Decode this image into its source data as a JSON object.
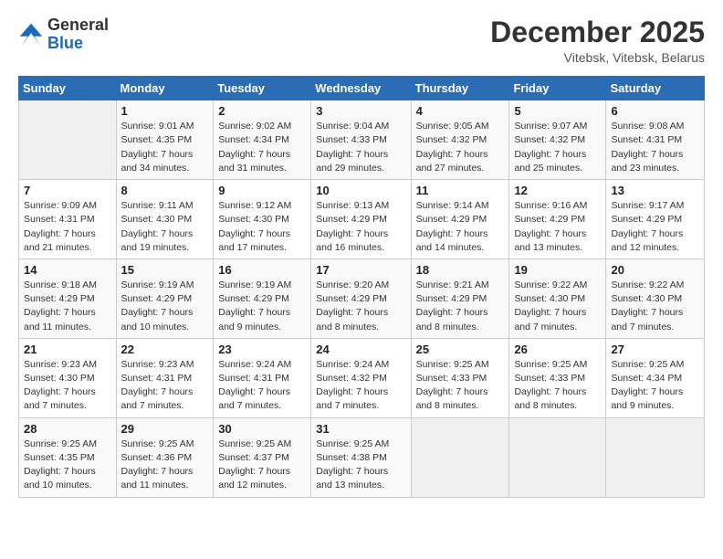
{
  "header": {
    "logo_general": "General",
    "logo_blue": "Blue",
    "month": "December 2025",
    "location": "Vitebsk, Vitebsk, Belarus"
  },
  "weekdays": [
    "Sunday",
    "Monday",
    "Tuesday",
    "Wednesday",
    "Thursday",
    "Friday",
    "Saturday"
  ],
  "weeks": [
    [
      {
        "day": "",
        "sunrise": "",
        "sunset": "",
        "daylight": ""
      },
      {
        "day": "1",
        "sunrise": "Sunrise: 9:01 AM",
        "sunset": "Sunset: 4:35 PM",
        "daylight": "Daylight: 7 hours and 34 minutes."
      },
      {
        "day": "2",
        "sunrise": "Sunrise: 9:02 AM",
        "sunset": "Sunset: 4:34 PM",
        "daylight": "Daylight: 7 hours and 31 minutes."
      },
      {
        "day": "3",
        "sunrise": "Sunrise: 9:04 AM",
        "sunset": "Sunset: 4:33 PM",
        "daylight": "Daylight: 7 hours and 29 minutes."
      },
      {
        "day": "4",
        "sunrise": "Sunrise: 9:05 AM",
        "sunset": "Sunset: 4:32 PM",
        "daylight": "Daylight: 7 hours and 27 minutes."
      },
      {
        "day": "5",
        "sunrise": "Sunrise: 9:07 AM",
        "sunset": "Sunset: 4:32 PM",
        "daylight": "Daylight: 7 hours and 25 minutes."
      },
      {
        "day": "6",
        "sunrise": "Sunrise: 9:08 AM",
        "sunset": "Sunset: 4:31 PM",
        "daylight": "Daylight: 7 hours and 23 minutes."
      }
    ],
    [
      {
        "day": "7",
        "sunrise": "Sunrise: 9:09 AM",
        "sunset": "Sunset: 4:31 PM",
        "daylight": "Daylight: 7 hours and 21 minutes."
      },
      {
        "day": "8",
        "sunrise": "Sunrise: 9:11 AM",
        "sunset": "Sunset: 4:30 PM",
        "daylight": "Daylight: 7 hours and 19 minutes."
      },
      {
        "day": "9",
        "sunrise": "Sunrise: 9:12 AM",
        "sunset": "Sunset: 4:30 PM",
        "daylight": "Daylight: 7 hours and 17 minutes."
      },
      {
        "day": "10",
        "sunrise": "Sunrise: 9:13 AM",
        "sunset": "Sunset: 4:29 PM",
        "daylight": "Daylight: 7 hours and 16 minutes."
      },
      {
        "day": "11",
        "sunrise": "Sunrise: 9:14 AM",
        "sunset": "Sunset: 4:29 PM",
        "daylight": "Daylight: 7 hours and 14 minutes."
      },
      {
        "day": "12",
        "sunrise": "Sunrise: 9:16 AM",
        "sunset": "Sunset: 4:29 PM",
        "daylight": "Daylight: 7 hours and 13 minutes."
      },
      {
        "day": "13",
        "sunrise": "Sunrise: 9:17 AM",
        "sunset": "Sunset: 4:29 PM",
        "daylight": "Daylight: 7 hours and 12 minutes."
      }
    ],
    [
      {
        "day": "14",
        "sunrise": "Sunrise: 9:18 AM",
        "sunset": "Sunset: 4:29 PM",
        "daylight": "Daylight: 7 hours and 11 minutes."
      },
      {
        "day": "15",
        "sunrise": "Sunrise: 9:19 AM",
        "sunset": "Sunset: 4:29 PM",
        "daylight": "Daylight: 7 hours and 10 minutes."
      },
      {
        "day": "16",
        "sunrise": "Sunrise: 9:19 AM",
        "sunset": "Sunset: 4:29 PM",
        "daylight": "Daylight: 7 hours and 9 minutes."
      },
      {
        "day": "17",
        "sunrise": "Sunrise: 9:20 AM",
        "sunset": "Sunset: 4:29 PM",
        "daylight": "Daylight: 7 hours and 8 minutes."
      },
      {
        "day": "18",
        "sunrise": "Sunrise: 9:21 AM",
        "sunset": "Sunset: 4:29 PM",
        "daylight": "Daylight: 7 hours and 8 minutes."
      },
      {
        "day": "19",
        "sunrise": "Sunrise: 9:22 AM",
        "sunset": "Sunset: 4:30 PM",
        "daylight": "Daylight: 7 hours and 7 minutes."
      },
      {
        "day": "20",
        "sunrise": "Sunrise: 9:22 AM",
        "sunset": "Sunset: 4:30 PM",
        "daylight": "Daylight: 7 hours and 7 minutes."
      }
    ],
    [
      {
        "day": "21",
        "sunrise": "Sunrise: 9:23 AM",
        "sunset": "Sunset: 4:30 PM",
        "daylight": "Daylight: 7 hours and 7 minutes."
      },
      {
        "day": "22",
        "sunrise": "Sunrise: 9:23 AM",
        "sunset": "Sunset: 4:31 PM",
        "daylight": "Daylight: 7 hours and 7 minutes."
      },
      {
        "day": "23",
        "sunrise": "Sunrise: 9:24 AM",
        "sunset": "Sunset: 4:31 PM",
        "daylight": "Daylight: 7 hours and 7 minutes."
      },
      {
        "day": "24",
        "sunrise": "Sunrise: 9:24 AM",
        "sunset": "Sunset: 4:32 PM",
        "daylight": "Daylight: 7 hours and 7 minutes."
      },
      {
        "day": "25",
        "sunrise": "Sunrise: 9:25 AM",
        "sunset": "Sunset: 4:33 PM",
        "daylight": "Daylight: 7 hours and 8 minutes."
      },
      {
        "day": "26",
        "sunrise": "Sunrise: 9:25 AM",
        "sunset": "Sunset: 4:33 PM",
        "daylight": "Daylight: 7 hours and 8 minutes."
      },
      {
        "day": "27",
        "sunrise": "Sunrise: 9:25 AM",
        "sunset": "Sunset: 4:34 PM",
        "daylight": "Daylight: 7 hours and 9 minutes."
      }
    ],
    [
      {
        "day": "28",
        "sunrise": "Sunrise: 9:25 AM",
        "sunset": "Sunset: 4:35 PM",
        "daylight": "Daylight: 7 hours and 10 minutes."
      },
      {
        "day": "29",
        "sunrise": "Sunrise: 9:25 AM",
        "sunset": "Sunset: 4:36 PM",
        "daylight": "Daylight: 7 hours and 11 minutes."
      },
      {
        "day": "30",
        "sunrise": "Sunrise: 9:25 AM",
        "sunset": "Sunset: 4:37 PM",
        "daylight": "Daylight: 7 hours and 12 minutes."
      },
      {
        "day": "31",
        "sunrise": "Sunrise: 9:25 AM",
        "sunset": "Sunset: 4:38 PM",
        "daylight": "Daylight: 7 hours and 13 minutes."
      },
      {
        "day": "",
        "sunrise": "",
        "sunset": "",
        "daylight": ""
      },
      {
        "day": "",
        "sunrise": "",
        "sunset": "",
        "daylight": ""
      },
      {
        "day": "",
        "sunrise": "",
        "sunset": "",
        "daylight": ""
      }
    ]
  ]
}
